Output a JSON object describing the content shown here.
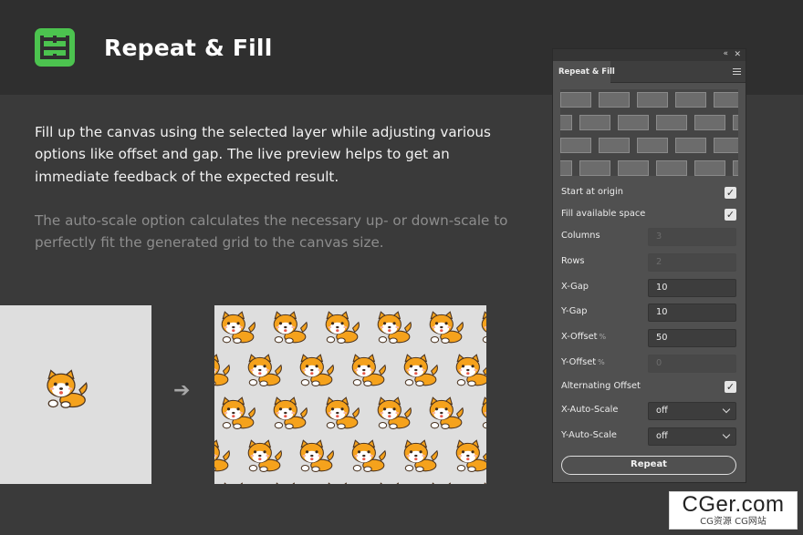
{
  "header": {
    "title": "Repeat & Fill"
  },
  "intro": {
    "primary": "Fill up the canvas using the selected layer while adjusting various options like offset and gap. The live preview helps to get an immediate feedback of the expected result.",
    "secondary": "The auto-scale option calculates the necessary up- or down-scale to perfectly fit the generated grid to the canvas size."
  },
  "illustration": {
    "arrow": "➔"
  },
  "panel": {
    "collapse_glyph": "«",
    "close_glyph": "✕",
    "tab_label": "Repeat & Fill",
    "check_glyph": "✓",
    "options": {
      "start_at_origin": {
        "label": "Start at origin",
        "checked": true
      },
      "fill_available_space": {
        "label": "Fill available space",
        "checked": true
      },
      "alternating_offset": {
        "label": "Alternating Offset",
        "checked": true
      }
    },
    "fields": {
      "columns": {
        "label": "Columns",
        "value": "3",
        "disabled": true
      },
      "rows": {
        "label": "Rows",
        "value": "2",
        "disabled": true
      },
      "x_gap": {
        "label": "X-Gap",
        "value": "10"
      },
      "y_gap": {
        "label": "Y-Gap",
        "value": "10"
      },
      "x_offset": {
        "label": "X-Offset",
        "unit": "%",
        "value": "50"
      },
      "y_offset": {
        "label": "Y-Offset",
        "unit": "%",
        "value": "0",
        "disabled": true
      }
    },
    "selects": {
      "x_auto_scale": {
        "label": "X-Auto-Scale",
        "value": "off"
      },
      "y_auto_scale": {
        "label": "Y-Auto-Scale",
        "value": "off"
      }
    },
    "repeat_button": "Repeat"
  },
  "watermark": {
    "main": "CGer.com",
    "sub": "CG资源 CG网站"
  },
  "colors": {
    "logo_green": "#4cc34f",
    "dog_orange": "#f5a21c"
  }
}
